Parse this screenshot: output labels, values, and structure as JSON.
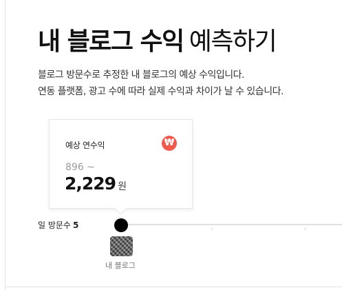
{
  "header": {
    "title_strong": "내 블로그 수익",
    "title_light": "예측하기"
  },
  "description": {
    "line1": "블로그 방문수로 추정한 내 블로그의 예상 수익입니다.",
    "line2": "연동 플랫폼, 광고 수에 따라 실제 수익과 차이가 날 수 있습니다."
  },
  "estimate_card": {
    "label": "예상 연수익",
    "currency_symbol": "₩",
    "badge_color": "#f05a4a",
    "range_min": "896 ~",
    "range_max": "2,229",
    "unit": "원"
  },
  "visitors": {
    "label": "일 방문수",
    "value": "5",
    "slider_position": 0
  },
  "blog": {
    "caption": "내 블로그"
  }
}
